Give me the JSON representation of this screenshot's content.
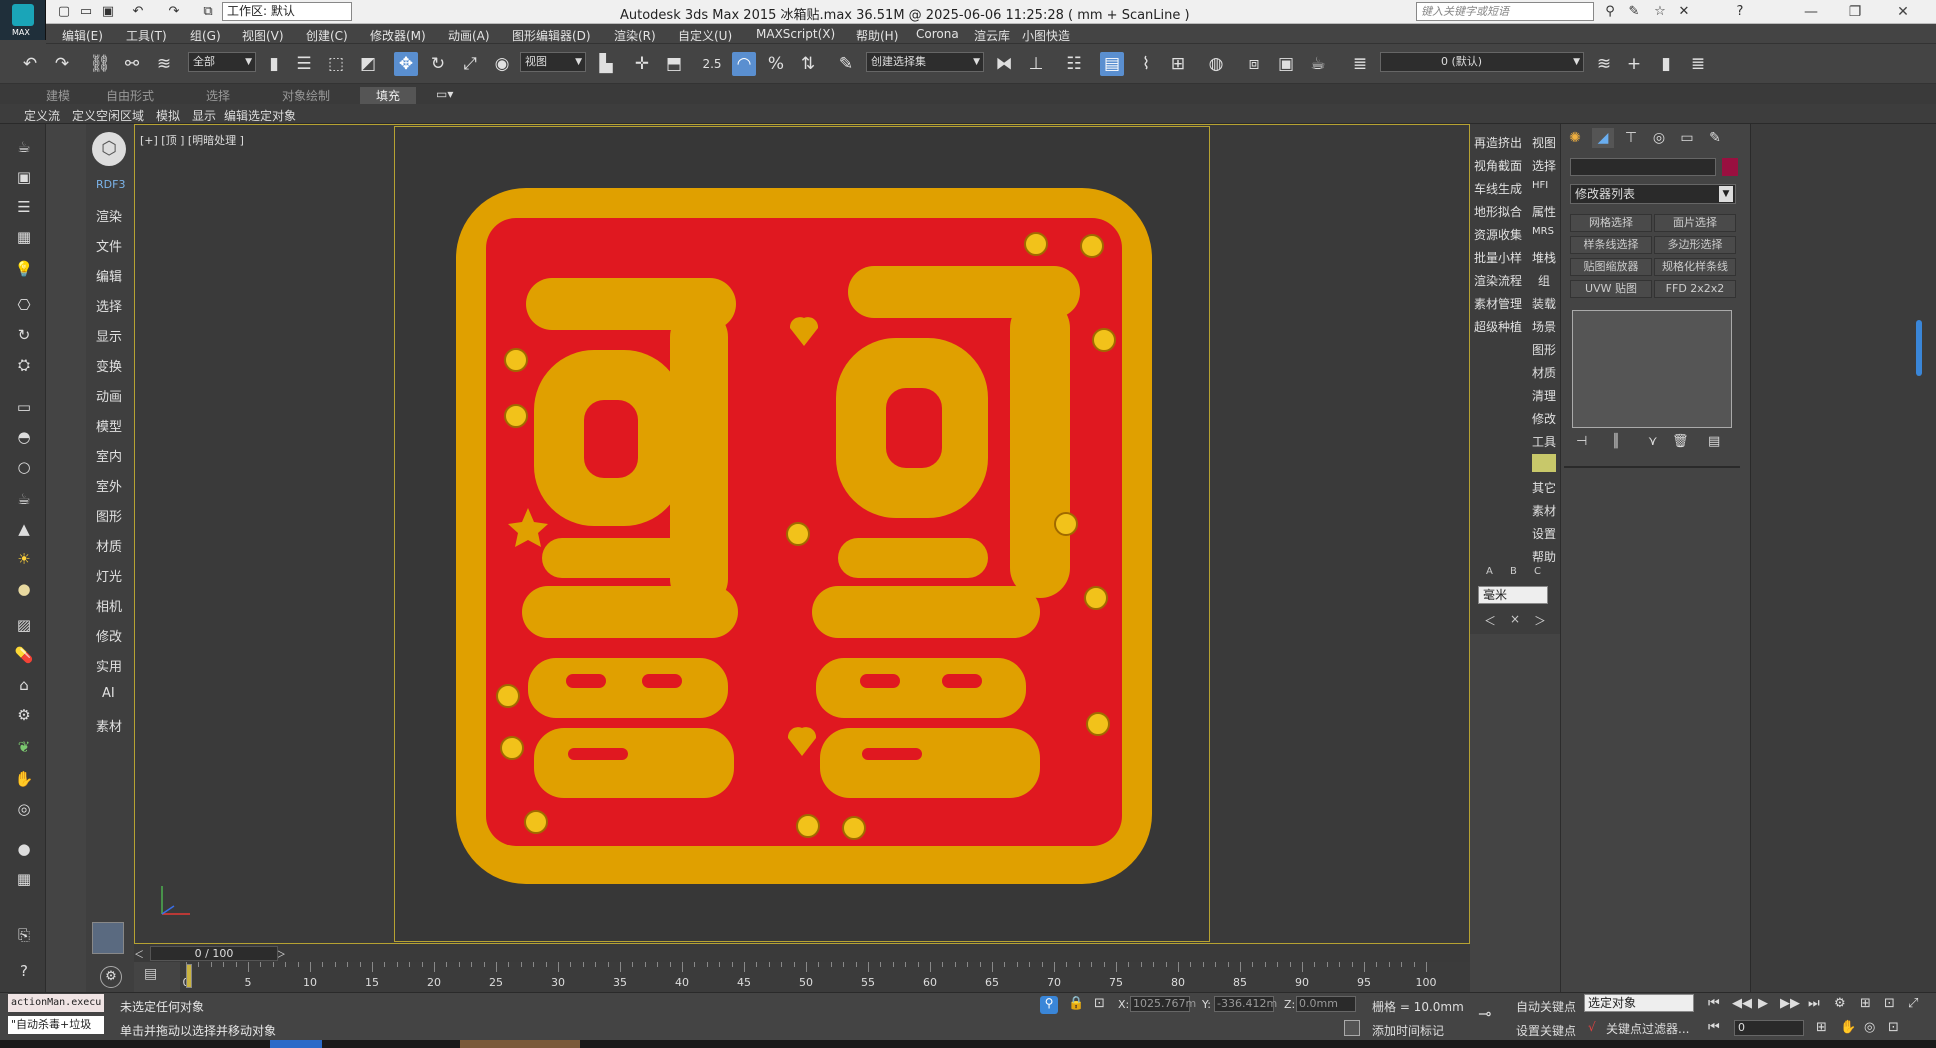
{
  "title_bar": {
    "title": "Autodesk 3ds Max  2015      冰箱贴.max  36.51M @ 2025-06-06 11:25:28  ( mm + ScanLine )",
    "workspace": "工作区: 默认",
    "search_placeholder": "键入关键字或短语",
    "logo_text": "MAX"
  },
  "menu": [
    "编辑(E)",
    "工具(T)",
    "组(G)",
    "视图(V)",
    "创建(C)",
    "修改器(M)",
    "动画(A)",
    "图形编辑器(D)",
    "渲染(R)",
    "自定义(U)",
    "MAXScript(X)",
    "帮助(H)",
    "Corona",
    "渲云库",
    "小图快造"
  ],
  "toolbar": {
    "selection_filter": "全部",
    "ref_coord": "视图",
    "snap_value": "2.5",
    "named_selection": "创建选择集",
    "layer": "0 (默认)"
  },
  "ribbon": {
    "tabs": [
      "建模",
      "自由形式",
      "选择",
      "对象绘制",
      "填充"
    ],
    "selected": "填充",
    "sub_items": [
      "定义流",
      "定义空闲区域",
      "模拟",
      "显示",
      "编辑选定对象"
    ]
  },
  "left_menu": {
    "brand": "RDF3",
    "items": [
      "渲染",
      "文件",
      "编辑",
      "选择",
      "显示",
      "变换",
      "动画",
      "模型",
      "室内",
      "室外",
      "图形",
      "材质",
      "灯光",
      "相机",
      "修改",
      "实用",
      "AI",
      "素材"
    ]
  },
  "viewport": {
    "label": "[+] [顶 ] [明暗处理 ]"
  },
  "right_menu": {
    "col_a": [
      "再造挤出",
      "视角截面",
      "车线生成",
      "地形拟合",
      "资源收集",
      "批量小样",
      "渲染流程",
      "素材管理",
      "超级种植"
    ],
    "col_b": [
      "视图",
      "选择",
      "HFI",
      "属性",
      "MRS",
      "堆栈",
      "组",
      "装载",
      "场景",
      "图形",
      "材质",
      "清理",
      "修改",
      "工具",
      "",
      "其它",
      "素材",
      "设置",
      "帮助"
    ],
    "abc": [
      "A",
      "B",
      "C"
    ],
    "units": "毫米"
  },
  "command_panel": {
    "modifier_list": "修改器列表",
    "buttons": [
      "网格选择",
      "面片选择",
      "样条线选择",
      "多边形选择",
      "贴图缩放器",
      "规格化样条线",
      "UVW 贴图",
      "FFD 2x2x2"
    ]
  },
  "timeline": {
    "frame_indicator": "0 / 100",
    "ticks": [
      0,
      5,
      10,
      15,
      20,
      25,
      30,
      35,
      40,
      45,
      50,
      55,
      60,
      65,
      70,
      75,
      80,
      85,
      90,
      95,
      100
    ]
  },
  "status": {
    "maxscript_1": "actionMan.execu",
    "maxscript_2": "\"自动杀毒+垃圾",
    "line_1": "未选定任何对象",
    "line_2": "单击并拖动以选择并移动对象",
    "x_label": "X:",
    "x_value": "1025.767m",
    "y_label": "Y:",
    "y_value": "-336.412m",
    "z_label": "Z:",
    "z_value": "0.0mm",
    "grid": "栅格 = 10.0mm",
    "add_time_tag": "添加时间标记",
    "auto_key": "自动关键点",
    "set_key": "设置关键点",
    "selection_set": "选定对象",
    "key_filter": "关键点过滤器...",
    "current_frame": "0"
  },
  "seal": {
    "text_rows": [
      "可可",
      "爱爱"
    ],
    "outer_color": "#e0a000",
    "inner_color": "#e01820",
    "glyph_color": "#e0a000"
  }
}
